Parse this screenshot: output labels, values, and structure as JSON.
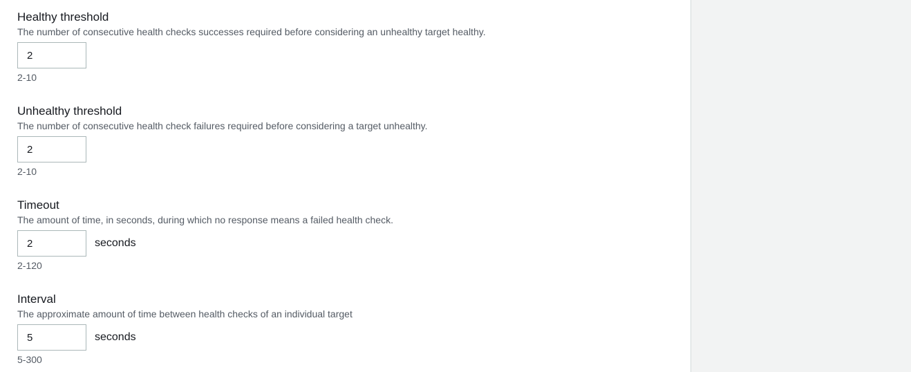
{
  "fields": [
    {
      "label": "Healthy threshold",
      "description": "The number of consecutive health checks successes required before considering an unhealthy target healthy.",
      "value": "2",
      "unit": "",
      "constraint": "2-10"
    },
    {
      "label": "Unhealthy threshold",
      "description": "The number of consecutive health check failures required before considering a target unhealthy.",
      "value": "2",
      "unit": "",
      "constraint": "2-10"
    },
    {
      "label": "Timeout",
      "description": "The amount of time, in seconds, during which no response means a failed health check.",
      "value": "2",
      "unit": "seconds",
      "constraint": "2-120"
    },
    {
      "label": "Interval",
      "description": "The approximate amount of time between health checks of an individual target",
      "value": "5",
      "unit": "seconds",
      "constraint": "5-300"
    }
  ]
}
